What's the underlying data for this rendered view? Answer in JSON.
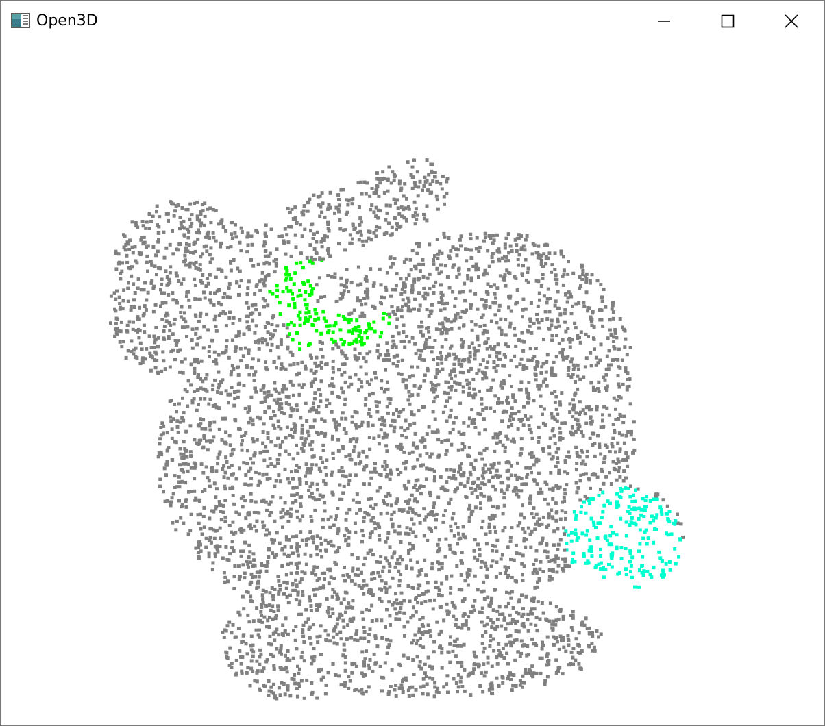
{
  "window": {
    "title": "Open3D",
    "controls": {
      "minimize_icon": "minimize-icon",
      "maximize_icon": "maximize-icon",
      "close_icon": "close-icon"
    }
  },
  "viewport": {
    "background_color": "#ffffff",
    "point_size": 5,
    "default_point_color": "#808080",
    "highlight_colors": {
      "neck_region": "#00ff00",
      "tail_region": "#00ffd0"
    }
  }
}
